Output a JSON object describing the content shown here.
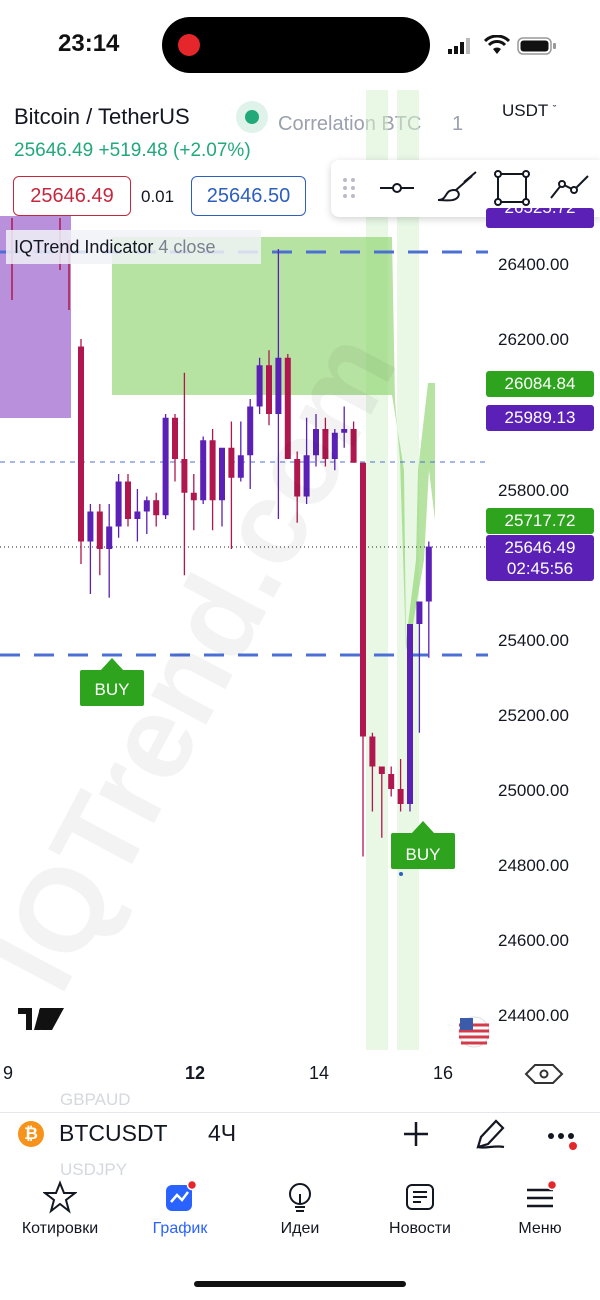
{
  "status_bar": {
    "time": "23:14"
  },
  "header": {
    "symbol_title": "Bitcoin / TetherUS",
    "correlation_label": "Correlation BTC",
    "correlation_value": "1",
    "currency": "USDT",
    "last_price": "25646.49",
    "change": "+519.48 (+2.07%)",
    "bid": "25646.49",
    "spread": "0.01",
    "ask": "25646.50"
  },
  "indicator": {
    "name": "IQTrend Indicator",
    "params": "4 close"
  },
  "watermark": "IQTrend.com",
  "price_axis": [
    "26400.00",
    "26200.00",
    "25800.00",
    "25400.00",
    "25200.00",
    "25000.00",
    "24800.00",
    "24600.00",
    "24400.00"
  ],
  "price_tags": {
    "top_cut": "26525.72",
    "green_upper": "26084.84",
    "purple_upper": "25989.13",
    "green_lower": "25717.72",
    "last": "25646.49",
    "countdown": "02:45:56"
  },
  "signals": [
    "BUY",
    "BUY"
  ],
  "time_axis": [
    "9",
    "12",
    "14",
    "16"
  ],
  "colors": {
    "up": "#5b21b6",
    "down": "#b0174f",
    "zone": "#8fd46e",
    "buy": "#2ea31d",
    "accent": "#2962ff"
  },
  "chart_data": {
    "type": "candlestick",
    "x_ticks": [
      "9",
      "12",
      "14",
      "16"
    ],
    "ylim": [
      24300,
      26560
    ],
    "y_ticks": [
      24400,
      24600,
      24800,
      25000,
      25200,
      25400,
      25800,
      26200,
      26400
    ],
    "candles": [
      {
        "o": 26180,
        "h": 26200,
        "l": 25600,
        "c": 25660
      },
      {
        "o": 25660,
        "h": 25760,
        "l": 25520,
        "c": 25740
      },
      {
        "o": 25740,
        "h": 25760,
        "l": 25570,
        "c": 25640
      },
      {
        "o": 25640,
        "h": 25760,
        "l": 25510,
        "c": 25700
      },
      {
        "o": 25700,
        "h": 25840,
        "l": 25670,
        "c": 25820
      },
      {
        "o": 25820,
        "h": 25840,
        "l": 25700,
        "c": 25720
      },
      {
        "o": 25720,
        "h": 25800,
        "l": 25660,
        "c": 25740
      },
      {
        "o": 25740,
        "h": 25780,
        "l": 25680,
        "c": 25770
      },
      {
        "o": 25770,
        "h": 25790,
        "l": 25700,
        "c": 25730
      },
      {
        "o": 25730,
        "h": 26000,
        "l": 25720,
        "c": 25990
      },
      {
        "o": 25990,
        "h": 26000,
        "l": 25820,
        "c": 25880
      },
      {
        "o": 25880,
        "h": 26110,
        "l": 25570,
        "c": 25790
      },
      {
        "o": 25790,
        "h": 25840,
        "l": 25690,
        "c": 25770
      },
      {
        "o": 25770,
        "h": 25940,
        "l": 25760,
        "c": 25930
      },
      {
        "o": 25930,
        "h": 25960,
        "l": 25690,
        "c": 25770
      },
      {
        "o": 25770,
        "h": 25900,
        "l": 25700,
        "c": 25910
      },
      {
        "o": 25910,
        "h": 25980,
        "l": 25640,
        "c": 25830
      },
      {
        "o": 25830,
        "h": 25980,
        "l": 25820,
        "c": 25890
      },
      {
        "o": 25890,
        "h": 26040,
        "l": 25800,
        "c": 26020
      },
      {
        "o": 26020,
        "h": 26150,
        "l": 26000,
        "c": 26130
      },
      {
        "o": 26130,
        "h": 26170,
        "l": 25970,
        "c": 26000
      },
      {
        "o": 26000,
        "h": 26440,
        "l": 25720,
        "c": 26150
      },
      {
        "o": 26150,
        "h": 26160,
        "l": 25880,
        "c": 25880
      },
      {
        "o": 25880,
        "h": 25900,
        "l": 25710,
        "c": 25780
      },
      {
        "o": 25780,
        "h": 25990,
        "l": 25760,
        "c": 25890
      },
      {
        "o": 25890,
        "h": 26000,
        "l": 25860,
        "c": 25960
      },
      {
        "o": 25960,
        "h": 25990,
        "l": 25860,
        "c": 25880
      },
      {
        "o": 25880,
        "h": 25960,
        "l": 25850,
        "c": 25950
      },
      {
        "o": 25950,
        "h": 26020,
        "l": 25910,
        "c": 25960
      },
      {
        "o": 25960,
        "h": 25980,
        "l": 25870,
        "c": 25870
      },
      {
        "o": 25870,
        "h": 25870,
        "l": 24820,
        "c": 25140
      },
      {
        "o": 25140,
        "h": 25150,
        "l": 24940,
        "c": 25060
      },
      {
        "o": 25060,
        "h": 25060,
        "l": 24870,
        "c": 25040
      },
      {
        "o": 25040,
        "h": 25060,
        "l": 24980,
        "c": 25000
      },
      {
        "o": 25000,
        "h": 25080,
        "l": 24940,
        "c": 24960
      },
      {
        "o": 24960,
        "h": 25440,
        "l": 24940,
        "c": 25440
      },
      {
        "o": 25440,
        "h": 25500,
        "l": 25150,
        "c": 25500
      },
      {
        "o": 25500,
        "h": 25660,
        "l": 25350,
        "c": 25646.49
      }
    ]
  }
}
